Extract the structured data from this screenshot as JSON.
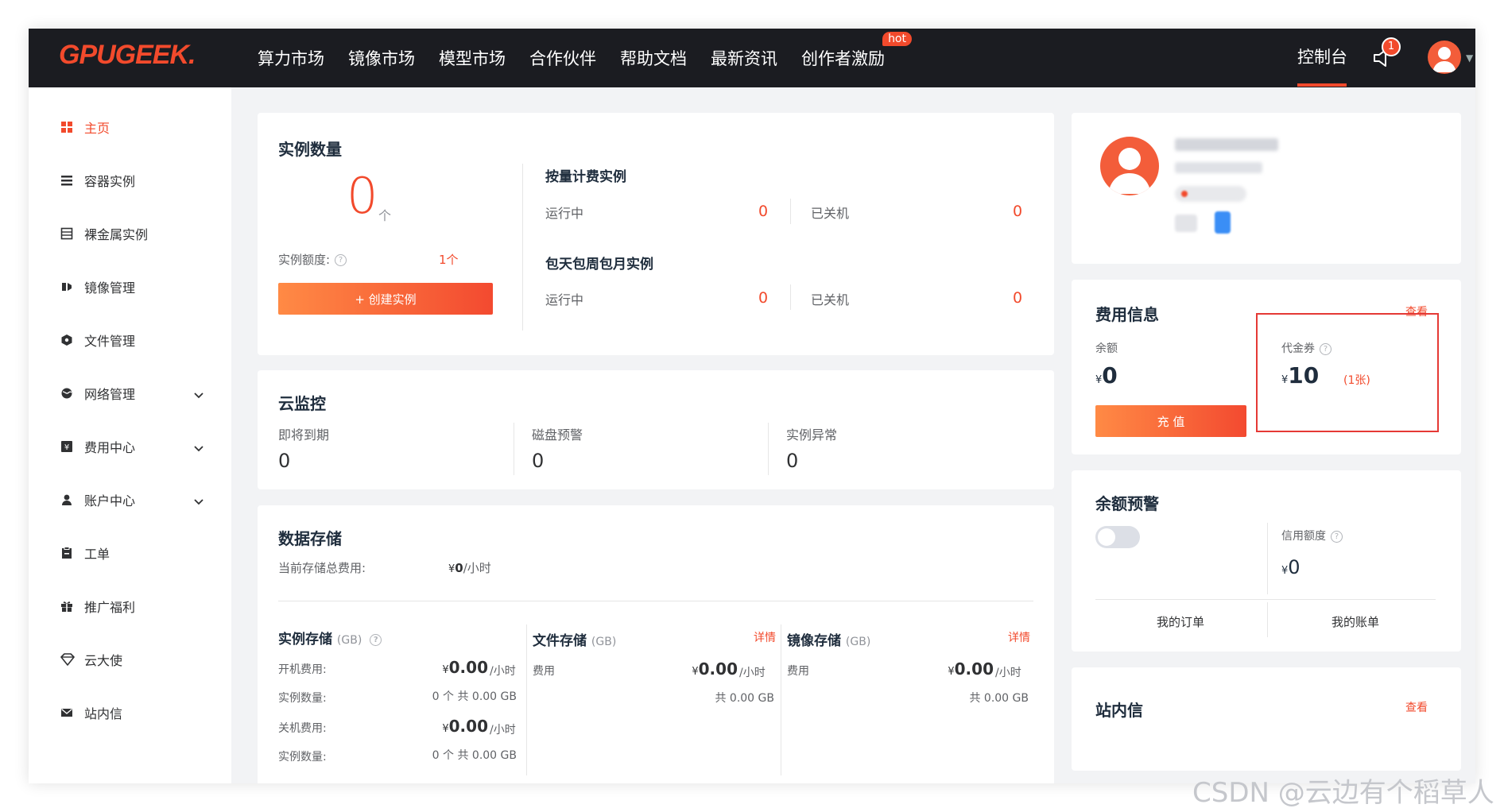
{
  "brand": {
    "logo_main": "GPUGEEK",
    "logo_dot": "."
  },
  "nav": {
    "items": [
      "算力市场",
      "镜像市场",
      "模型市场",
      "合作伙伴",
      "帮助文档",
      "最新资讯",
      "创作者激励"
    ],
    "hot_badge": "hot",
    "console": "控制台",
    "bell_count": "1"
  },
  "sidebar": {
    "items": [
      {
        "label": "主页",
        "icon": "home-grid-icon"
      },
      {
        "label": "容器实例",
        "icon": "list-icon"
      },
      {
        "label": "裸金属实例",
        "icon": "server-icon"
      },
      {
        "label": "镜像管理",
        "icon": "image-icon"
      },
      {
        "label": "文件管理",
        "icon": "folder-icon"
      },
      {
        "label": "网络管理",
        "icon": "globe-icon"
      },
      {
        "label": "费用中心",
        "icon": "currency-icon"
      },
      {
        "label": "账户中心",
        "icon": "user-icon"
      },
      {
        "label": "工单",
        "icon": "clipboard-icon"
      },
      {
        "label": "推广福利",
        "icon": "gift-icon"
      },
      {
        "label": "云大使",
        "icon": "diamond-icon"
      },
      {
        "label": "站内信",
        "icon": "mail-icon"
      }
    ]
  },
  "instances": {
    "title": "实例数量",
    "count": "0",
    "unit": "个",
    "quota_label": "实例额度:",
    "quota_value": "1个",
    "create_button": "+ 创建实例",
    "payg_title": "按量计费实例",
    "sub_title": "包天包周包月实例",
    "running": "运行中",
    "stopped": "已关机",
    "payg_running": "0",
    "payg_stopped": "0",
    "sub_running": "0",
    "sub_stopped": "0"
  },
  "monitor": {
    "title": "云监控",
    "items": [
      {
        "label": "即将到期",
        "value": "0"
      },
      {
        "label": "磁盘预警",
        "value": "0"
      },
      {
        "label": "实例异常",
        "value": "0"
      }
    ]
  },
  "storage": {
    "title": "数据存储",
    "total_label": "当前存储总费用:",
    "total_currency": "¥",
    "total_value": "0",
    "total_unit": "/小时",
    "instance": {
      "title": "实例存储",
      "unit": "(GB)",
      "on_fee_label": "开机费用:",
      "on_fee": "0.00",
      "on_count_label": "实例数量:",
      "on_count": "0 个 共 0.00 GB",
      "off_fee_label": "关机费用:",
      "off_fee": "0.00",
      "off_count_label": "实例数量:",
      "off_count": "0 个 共 0.00 GB"
    },
    "file": {
      "title": "文件存储",
      "unit": "(GB)",
      "detail": "详情",
      "fee_label": "费用",
      "fee": "0.00",
      "total": "共 0.00 GB"
    },
    "image": {
      "title": "镜像存储",
      "unit": "(GB)",
      "detail": "详情",
      "fee_label": "费用",
      "fee": "0.00",
      "total": "共 0.00 GB"
    },
    "currency": "¥",
    "per_hour": "/小时"
  },
  "billing": {
    "title": "费用信息",
    "view": "查看",
    "balance_label": "余额",
    "currency": "¥",
    "balance": "0",
    "recharge": "充 值",
    "voucher_label": "代金券",
    "voucher_value": "10",
    "voucher_count": "(1张)"
  },
  "alert": {
    "title": "余额预警",
    "toggle_on": false,
    "credit_label": "信用额度",
    "currency": "¥",
    "credit_value": "0",
    "my_orders": "我的订单",
    "my_bills": "我的账单"
  },
  "inbox": {
    "title": "站内信",
    "view": "查看"
  },
  "watermark": "CSDN @云边有个稻草人",
  "colors": {
    "accent": "#f24a2c",
    "topbar": "#1b1c21",
    "background": "#f2f3f5"
  }
}
